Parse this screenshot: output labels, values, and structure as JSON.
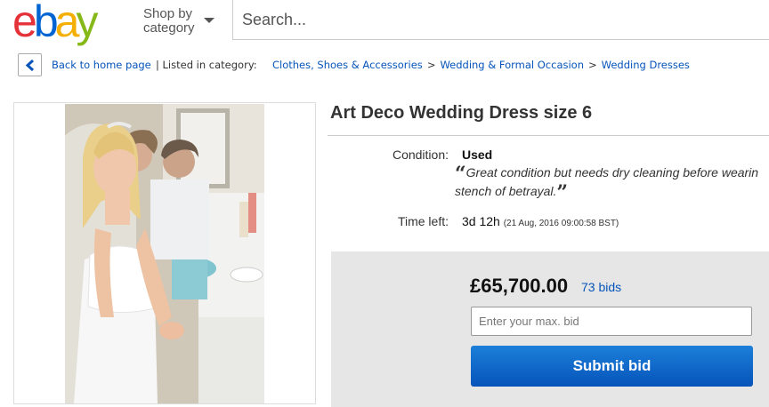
{
  "header": {
    "logo": [
      "e",
      "b",
      "a",
      "y"
    ],
    "shop_by_line1": "Shop by",
    "shop_by_line2": "category",
    "search_placeholder": "Search..."
  },
  "breadcrumb": {
    "back_label": "Back to home page",
    "listed_in": "| Listed in category:",
    "categories": [
      "Clothes, Shoes & Accessories",
      "Wedding & Formal Occasion",
      "Wedding Dresses"
    ],
    "separator": ">"
  },
  "listing": {
    "title": "Art Deco Wedding Dress size 6",
    "condition_label": "Condition:",
    "condition_value": "Used",
    "quote_open": "“",
    "quote_line1": "Great condition but needs dry cleaning before wearin",
    "quote_line2": "stench of betrayal.",
    "quote_close": "”",
    "time_left_label": "Time left:",
    "time_left_value": "3d 12h",
    "time_left_date": "(21 Aug, 2016   09:00:58 BST)"
  },
  "bid": {
    "price": "£65,700.00",
    "bids": "73 bids",
    "input_placeholder": "Enter your max. bid",
    "submit_label": "Submit bid"
  },
  "colors": {
    "link": "#0654ba",
    "button": "#0654ba",
    "bidbox_bg": "#e6e6e6"
  }
}
